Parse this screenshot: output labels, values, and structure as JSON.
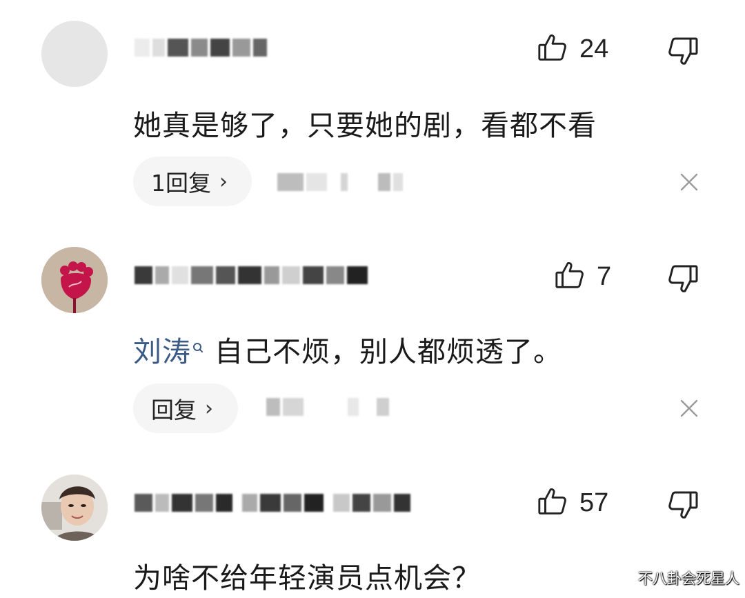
{
  "comments": [
    {
      "likes": "24",
      "text": "她真是够了，只要她的剧，看都不看",
      "reply_label": "1回复",
      "reply_chevron": "›"
    },
    {
      "likes": "7",
      "mention": "刘涛",
      "text": "自己不烦，别人都烦透了。",
      "reply_label": "回复",
      "reply_chevron": "›"
    },
    {
      "likes": "57",
      "text": "为啥不给年轻演员点机会？"
    }
  ],
  "watermark": "不八卦会死星人",
  "icons": {
    "like": "thumbs-up-icon",
    "dislike": "thumbs-down-icon",
    "close": "close-icon",
    "mention_search": "search-icon"
  },
  "colors": {
    "mention": "#3b5a86",
    "reply_bg": "#f5f5f5",
    "icon": "#222222"
  }
}
